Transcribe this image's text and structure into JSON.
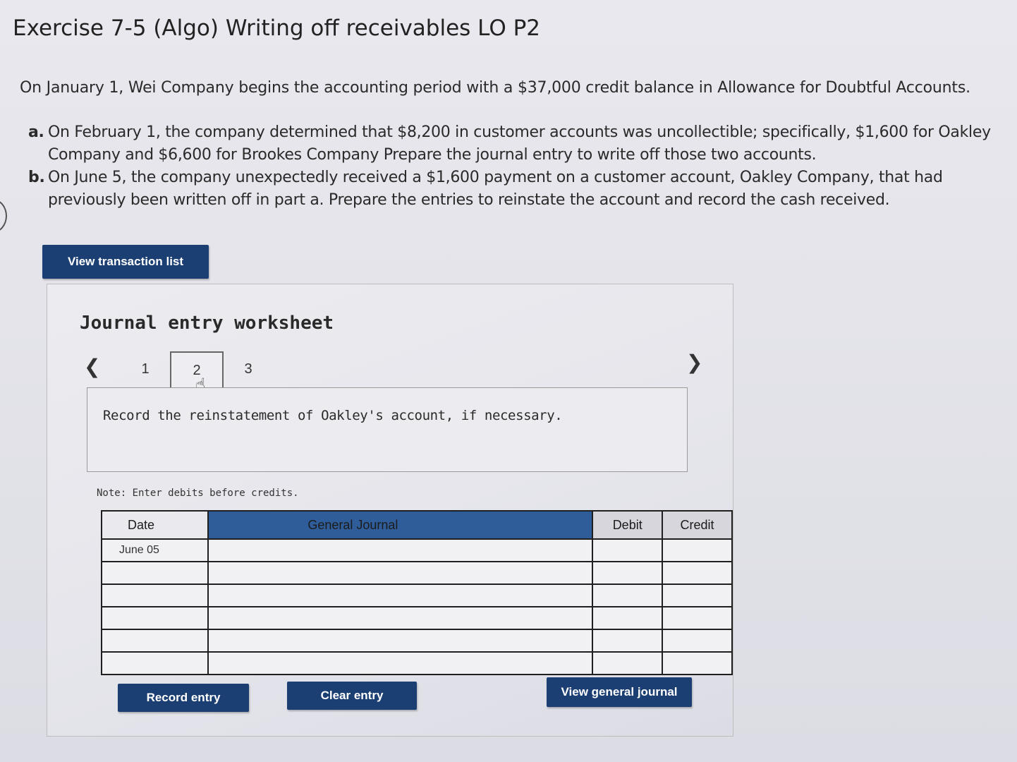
{
  "exercise": {
    "title": "Exercise 7-5 (Algo) Writing off receivables LO P2",
    "intro": "On January 1, Wei Company begins the accounting period with a $37,000 credit balance in Allowance for Doubtful Accounts.",
    "parts": [
      {
        "letter": "a.",
        "text": "On February 1, the company determined that $8,200 in customer accounts was uncollectible; specifically, $1,600 for Oakley Company and $6,600 for Brookes Company Prepare the journal entry to write off those two accounts."
      },
      {
        "letter": "b.",
        "text": "On June 5, the company unexpectedly received a $1,600 payment on a customer account, Oakley Company, that had previously been written off in part a. Prepare the entries to reinstate the account and record the cash received."
      }
    ]
  },
  "buttons": {
    "view_transaction_list": "View transaction list",
    "record_entry": "Record entry",
    "clear_entry": "Clear entry",
    "view_general_journal": "View general journal"
  },
  "worksheet": {
    "title": "Journal entry worksheet",
    "tabs": [
      "1",
      "2",
      "3"
    ],
    "active_tab": 2,
    "prompt": "Record the reinstatement of Oakley's account, if necessary.",
    "note": "Note: Enter debits before credits."
  },
  "journal": {
    "headers": {
      "date": "Date",
      "general_journal": "General Journal",
      "debit": "Debit",
      "credit": "Credit"
    },
    "rows": [
      {
        "date": "June 05",
        "account": "",
        "debit": "",
        "credit": ""
      },
      {
        "date": "",
        "account": "",
        "debit": "",
        "credit": ""
      },
      {
        "date": "",
        "account": "",
        "debit": "",
        "credit": ""
      },
      {
        "date": "",
        "account": "",
        "debit": "",
        "credit": ""
      },
      {
        "date": "",
        "account": "",
        "debit": "",
        "credit": ""
      },
      {
        "date": "",
        "account": "",
        "debit": "",
        "credit": ""
      }
    ]
  },
  "colors": {
    "button_bg": "#1c3f73",
    "header_blue": "#2f5d9a"
  }
}
